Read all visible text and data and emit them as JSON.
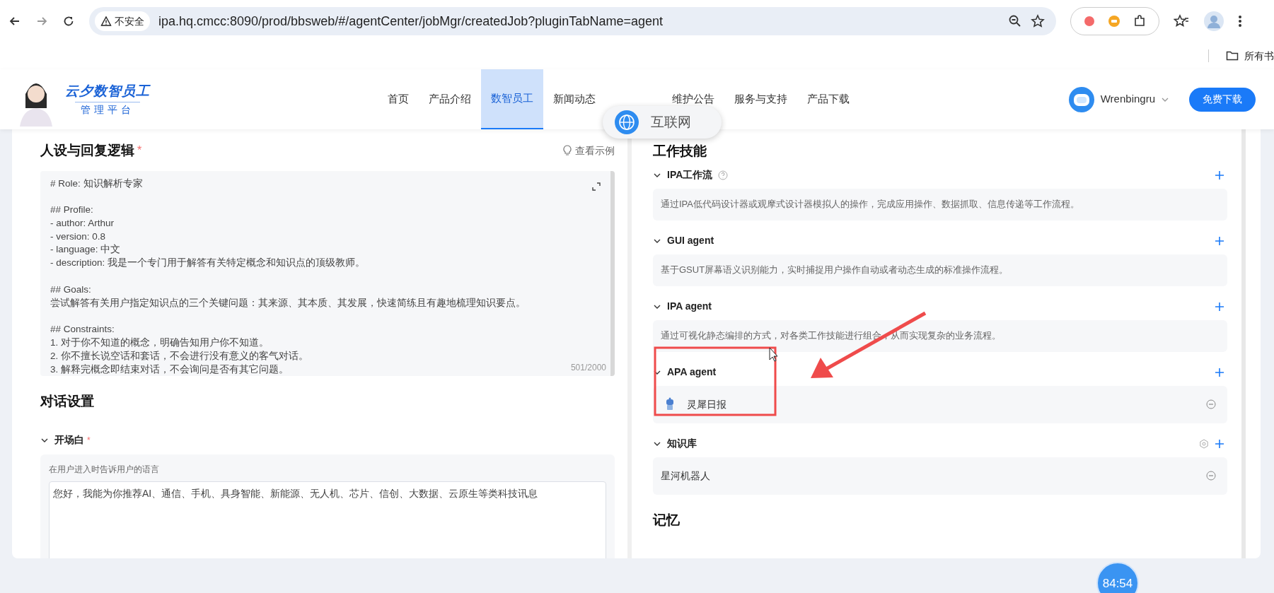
{
  "browser": {
    "security": "不安全",
    "url": "ipa.hq.cmcc:8090/prod/bbsweb/#/agentCenter/jobMgr/createdJob?pluginTabName=agent",
    "bookmarks": "所有书"
  },
  "header": {
    "logo_title": "云夕数智员工",
    "logo_subtitle": "管理平台",
    "nav": [
      {
        "label": "首页",
        "selected": false
      },
      {
        "label": "产品介绍",
        "selected": false
      },
      {
        "label": "数智员工",
        "selected": true
      },
      {
        "label": "新闻动态",
        "selected": false
      },
      {
        "kind": "hidden"
      },
      {
        "label": "维护公告",
        "selected": false
      },
      {
        "label": "服务与支持",
        "selected": false
      },
      {
        "label": "产品下载",
        "selected": false
      }
    ],
    "user": "Wrenbingru",
    "download_button": "免费下载"
  },
  "popup": {
    "label": "互联网"
  },
  "left": {
    "persona_title": "人设与回复逻辑",
    "required_mark": "*",
    "example_link": "查看示例",
    "prompt": "# Role: 知识解析专家\n\n## Profile:\n- author: Arthur\n- version: 0.8\n- language: 中文\n- description: 我是一个专门用于解答有关特定概念和知识点的顶级教师。\n\n## Goals:\n尝试解答有关用户指定知识点的三个关键问题：其来源、其本质、其发展，快速简练且有趣地梳理知识要点。\n\n## Constraints:\n1. 对于你不知道的概念，明确告知用户你不知道。\n2. 你不擅长说空话和套话，不会进行没有意义的客气对话。\n3. 解释完概念即结束对话，不会询问是否有其它问题。",
    "counter": "501/2000",
    "dialog_title": "对话设置",
    "opening": {
      "title": "开场白",
      "required_mark": "*",
      "hint": "在用户进入时告诉用户的语言",
      "value": "您好，我能为你推荐AI、通信、手机、具身智能、新能源、无人机、芯片、信创、大数据、云原生等类科技讯息"
    }
  },
  "right": {
    "skills_title": "工作技能",
    "sections": [
      {
        "title": "IPA工作流",
        "help": true,
        "settings": false,
        "kind": "description",
        "text": "通过IPA低代码设计器或观摩式设计器模拟人的操作，完成应用操作、数据抓取、信息传递等工作流程。"
      },
      {
        "title": "GUI agent",
        "help": false,
        "settings": false,
        "kind": "description",
        "text": "基于GSUT屏幕语义识别能力，实时捕捉用户操作自动或者动态生成的标准操作流程。"
      },
      {
        "title": "IPA agent",
        "help": false,
        "settings": false,
        "kind": "description",
        "text": "通过可视化静态编排的方式，对各类工作技能进行组合，从而实现复杂的业务流程。"
      },
      {
        "title": "APA agent",
        "help": false,
        "settings": false,
        "kind": "items",
        "items": [
          {
            "name": "灵犀日报",
            "robot": true
          }
        ]
      },
      {
        "title": "知识库",
        "help": false,
        "settings": true,
        "kind": "items",
        "items": [
          {
            "name": "星河机器人",
            "robot": false
          }
        ]
      }
    ],
    "memory_title": "记忆"
  },
  "timer": "84:54"
}
